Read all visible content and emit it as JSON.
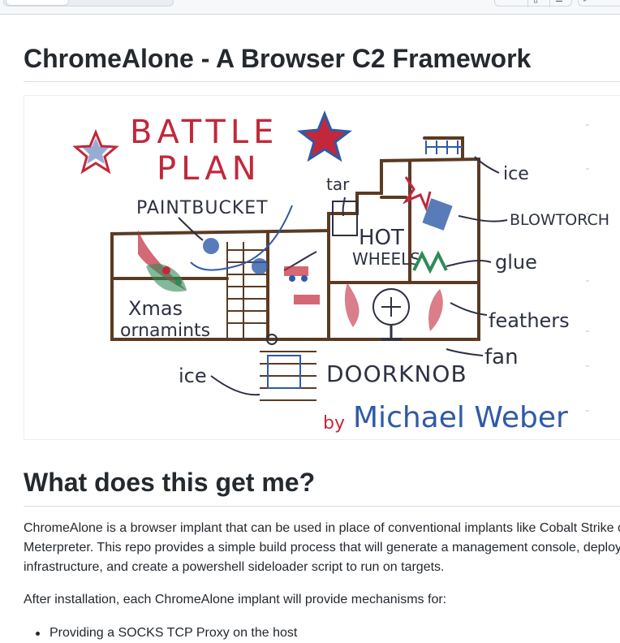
{
  "page": {
    "title": "ChromeAlone - A Browser C2 Framework",
    "section_heading": "What does this get me?",
    "paragraphs": [
      "ChromeAlone is a browser implant that can be used in place of conventional implants like Cobalt Strike or Meterpreter. This repo provides a simple build process that will generate a management console, deploy infrastructure, and create a powershell sideloader script to run on targets.",
      "After installation, each ChromeAlone implant will provide mechanisms for:"
    ],
    "list_items": [
      "Providing a SOCKS TCP Proxy on the host"
    ]
  },
  "figure": {
    "alt": "Battle plan drawing",
    "title_line1": "BATTLE",
    "title_line2": "PLAN",
    "credit_by": "by",
    "credit_name": "Michael Weber",
    "labels": {
      "paintbucket": "PAINTBUCKET",
      "tar": "tar",
      "ice_top": "ice",
      "blowtorch": "BLOWTORCH",
      "hot": "HOT",
      "wheels": "WHEELS",
      "glue": "glue",
      "xmas": "Xmas",
      "ornamints": "ornamints",
      "feathers": "feathers",
      "fan": "fan",
      "ice_bottom": "ice",
      "doorknob": "DOORKNOB"
    }
  },
  "colors": {
    "text": "#24292f",
    "rule": "#d8dee4",
    "toolbar_bg": "#f6f8fa",
    "border": "#d0d7de",
    "ink_brown": "#5a3b22",
    "ink_red": "#c2283a",
    "ink_blue": "#2f5aa8",
    "ink_dark": "#2d3142"
  },
  "icons": [
    "file-icon",
    "list-icon",
    "play-icon"
  ]
}
